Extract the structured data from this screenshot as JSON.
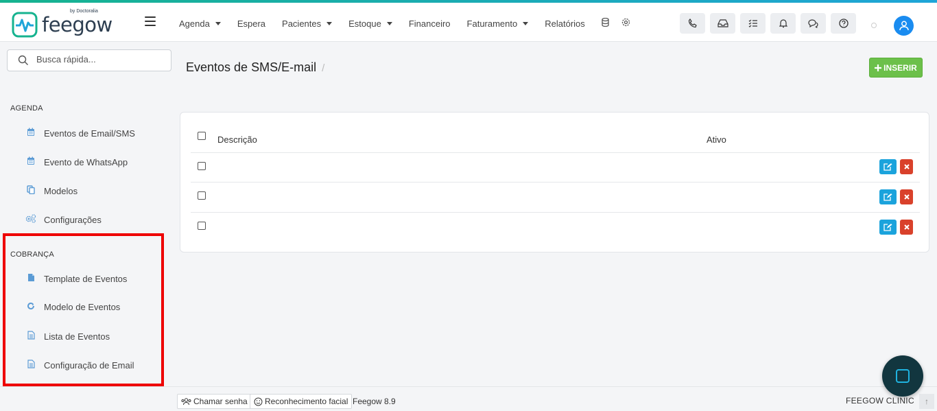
{
  "brand": {
    "name": "feegow",
    "byline": "by Doctoralia",
    "accent": "#1fa5d8",
    "green": "#16b38f"
  },
  "nav": {
    "menu": [
      {
        "label": "Agenda",
        "dropdown": true
      },
      {
        "label": "Espera",
        "dropdown": false
      },
      {
        "label": "Pacientes",
        "dropdown": true
      },
      {
        "label": "Estoque",
        "dropdown": true
      },
      {
        "label": "Financeiro",
        "dropdown": false
      },
      {
        "label": "Faturamento",
        "dropdown": true
      },
      {
        "label": "Relatórios",
        "dropdown": false
      }
    ],
    "icons": [
      "database-icon",
      "gear-icon"
    ],
    "buttons": [
      "phone-icon",
      "inbox-icon",
      "checklist-icon",
      "bell-icon",
      "chat-icon",
      "help-icon"
    ]
  },
  "search": {
    "placeholder": "Busca rápida..."
  },
  "sidebar": {
    "agenda_heading": "AGENDA",
    "agenda_items": [
      {
        "label": "Eventos de Email/SMS",
        "icon": "calendar-icon"
      },
      {
        "label": "Evento de WhatsApp",
        "icon": "calendar-icon"
      },
      {
        "label": "Modelos",
        "icon": "copy-icon"
      },
      {
        "label": "Configurações",
        "icon": "gears-icon"
      }
    ],
    "cobranca_heading": "COBRANÇA",
    "cobranca_items": [
      {
        "label": "Template de Eventos",
        "icon": "file-icon"
      },
      {
        "label": "Modelo de Eventos",
        "icon": "refresh-icon"
      },
      {
        "label": "Lista de Eventos",
        "icon": "file-text-icon"
      },
      {
        "label": "Configuração de Email",
        "icon": "file-text-icon"
      }
    ]
  },
  "main": {
    "title": "Eventos de SMS/E-mail",
    "breadcrumb_sep": "/",
    "insert_label": "INSERIR",
    "table": {
      "headers": {
        "description": "Descrição",
        "active": "Ativo"
      },
      "rows": [
        {
          "description": "",
          "active": ""
        },
        {
          "description": "",
          "active": ""
        },
        {
          "description": "",
          "active": ""
        }
      ]
    }
  },
  "footer": {
    "call_password": "Chamar senha",
    "face_recognition": "Reconhecimento facial",
    "version": "Feegow 8.9",
    "clinic": "FEEGOW CLINIC"
  }
}
